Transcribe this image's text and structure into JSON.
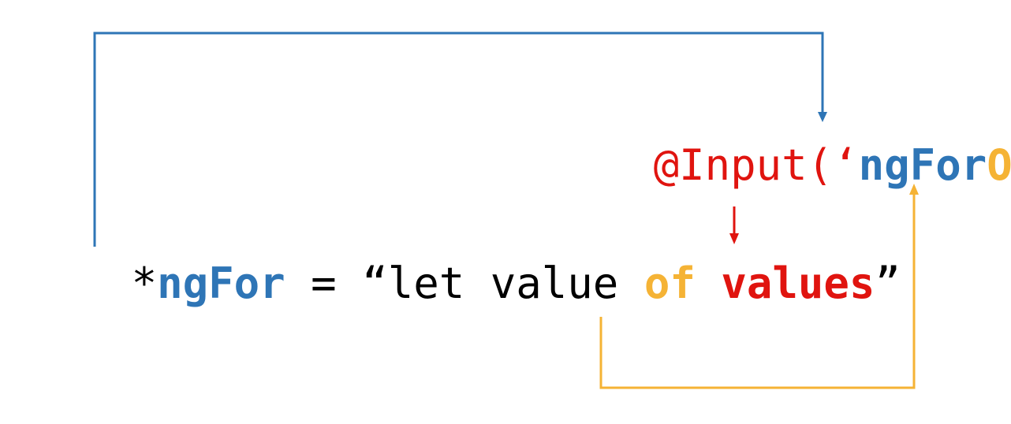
{
  "colors": {
    "blue": "#2E75B6",
    "red": "#E0140F",
    "orange": "#F5B335",
    "black": "#000000"
  },
  "top_line": {
    "at_input": "@Input(",
    "open_quote": "‘",
    "ng_for": "ngFor",
    "of": "Of",
    "close_quote": "’",
    "close_paren": ")"
  },
  "bottom_line": {
    "star": "*",
    "ng_for": "ngFor",
    "equals": " = ",
    "open_quote": "“",
    "let_value": "let value ",
    "of": "of",
    "space": " ",
    "values": "values",
    "close_quote": "”"
  }
}
